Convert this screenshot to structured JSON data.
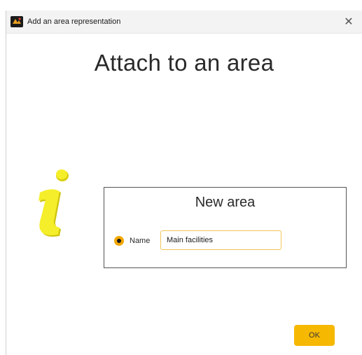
{
  "window": {
    "title": "Add an area representation",
    "close_symbol": "✕",
    "icons": {
      "app": "app-logo-icon",
      "close": "close-icon",
      "info": "info-icon"
    }
  },
  "dialog": {
    "heading": "Attach to an area",
    "panel": {
      "title": "New area",
      "radio_label": "Name",
      "radio_selected": true,
      "name_value": "Main facilities"
    },
    "ok_label": "OK"
  },
  "colors": {
    "accent": "#f6b800",
    "radio": "#f3a800",
    "input_border": "#f0c45a",
    "info_icon": "#f2ea1e"
  }
}
